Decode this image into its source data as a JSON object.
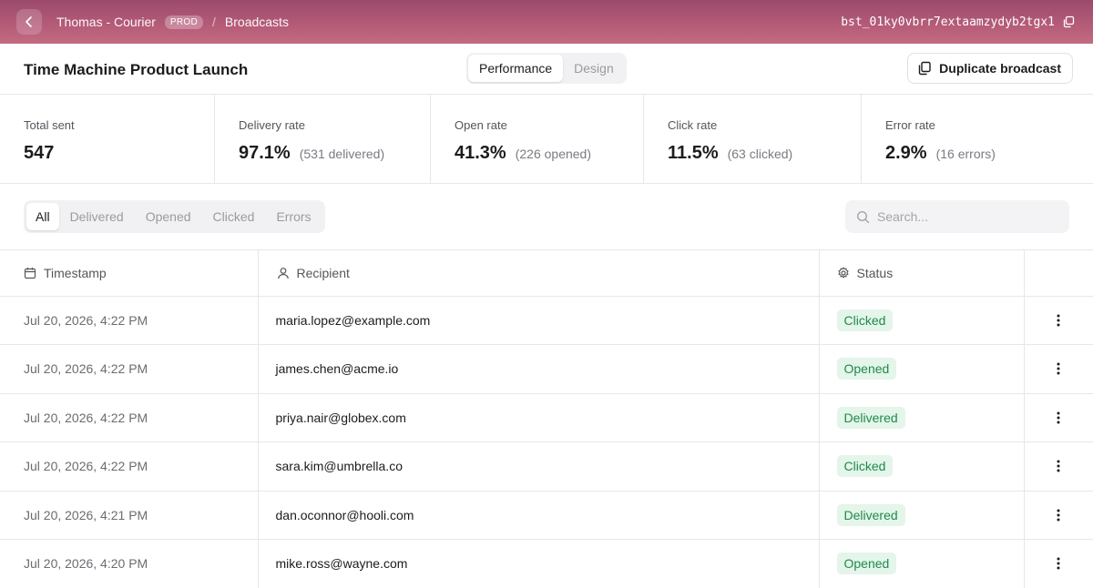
{
  "topbar": {
    "breadcrumbs": [
      "Thomas - Courier",
      "Broadcasts"
    ],
    "env_badge": "PROD",
    "separator": "/",
    "broadcast_id": "bst_01ky0vbrr7extaamzydyb2tgx1"
  },
  "header": {
    "title": "Time Machine Product Launch",
    "tabs": [
      {
        "label": "Performance",
        "active": true
      },
      {
        "label": "Design",
        "active": false
      }
    ],
    "duplicate_label": "Duplicate broadcast"
  },
  "stats": [
    {
      "label": "Total sent",
      "value": "547",
      "sub": ""
    },
    {
      "label": "Delivery rate",
      "value": "97.1%",
      "sub": "(531 delivered)"
    },
    {
      "label": "Open rate",
      "value": "41.3%",
      "sub": "(226 opened)"
    },
    {
      "label": "Click rate",
      "value": "11.5%",
      "sub": "(63 clicked)"
    },
    {
      "label": "Error rate",
      "value": "2.9%",
      "sub": "(16 errors)"
    }
  ],
  "filters": {
    "tabs": [
      "All",
      "Delivered",
      "Opened",
      "Clicked",
      "Errors"
    ],
    "active": "All",
    "search_placeholder": "Search..."
  },
  "table": {
    "columns": [
      "Timestamp",
      "Recipient",
      "Status"
    ],
    "rows": [
      {
        "timestamp": "Jul 20, 2026, 4:22 PM",
        "recipient": "maria.lopez@example.com",
        "status": "Clicked"
      },
      {
        "timestamp": "Jul 20, 2026, 4:22 PM",
        "recipient": "james.chen@acme.io",
        "status": "Opened"
      },
      {
        "timestamp": "Jul 20, 2026, 4:22 PM",
        "recipient": "priya.nair@globex.com",
        "status": "Delivered"
      },
      {
        "timestamp": "Jul 20, 2026, 4:22 PM",
        "recipient": "sara.kim@umbrella.co",
        "status": "Clicked"
      },
      {
        "timestamp": "Jul 20, 2026, 4:21 PM",
        "recipient": "dan.oconnor@hooli.com",
        "status": "Delivered"
      },
      {
        "timestamp": "Jul 20, 2026, 4:20 PM",
        "recipient": "mike.ross@wayne.com",
        "status": "Opened"
      }
    ]
  },
  "icons": {
    "back": "chevron-left-icon",
    "copy": "copy-icon",
    "duplicate": "duplicate-icon",
    "search": "search-icon",
    "timestamp": "calendar-icon",
    "recipient": "user-icon",
    "status": "gear-icon",
    "row_menu": "kebab-menu-icon"
  },
  "colors": {
    "topbar_top": "#9b4a6b",
    "topbar_bottom": "#c26b82",
    "status_badge_bg": "#e4f5ea",
    "status_badge_text": "#1f8a4c"
  }
}
